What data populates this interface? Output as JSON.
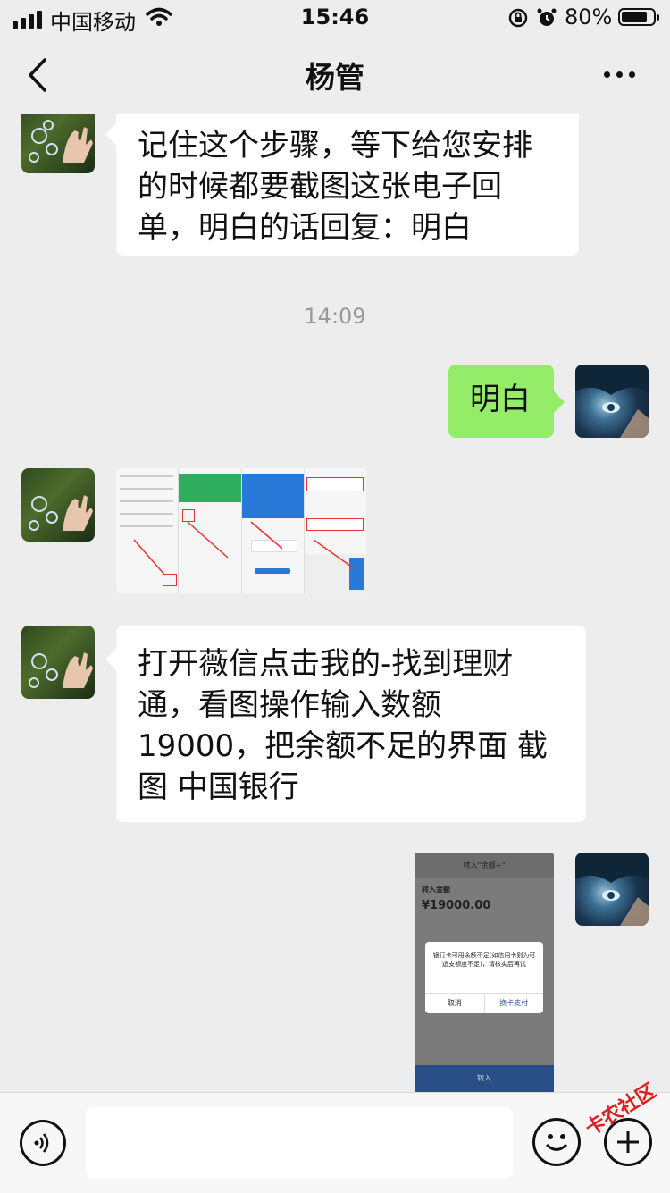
{
  "status_bar": {
    "carrier": "中国移动",
    "time": "15:46",
    "battery": "80%"
  },
  "header": {
    "title": "杨管"
  },
  "messages": {
    "m1": {
      "text": "记住这个步骤，等下给您安排的时候都要截图这张电子回单，明白的话回复：明白"
    },
    "timestamp": "14:09",
    "m2": {
      "text": "明白"
    },
    "m4": {
      "text": "打开薇信点击我的-找到理财通，看图操作输入数额19000，把余额不足的界面 截图  中国银行"
    }
  },
  "screenshot_receipt": {
    "header_title": "转入“余额+”",
    "label_amount": "转入金额",
    "amount": "¥19000.00",
    "dialog_text": "银行卡可用余额不足(如信用卡则为可透支额度不足)，请核实后再试",
    "cancel_label": "取消",
    "switch_card_label": "换卡支付",
    "confirm_label": "转入"
  },
  "watermark": "卡农社区",
  "icons": [
    "back-icon",
    "more-icon",
    "voice-icon",
    "emoji-icon",
    "plus-icon",
    "wifi-icon",
    "lock-rotation-icon",
    "alarm-icon",
    "battery-icon",
    "signal-icon"
  ]
}
